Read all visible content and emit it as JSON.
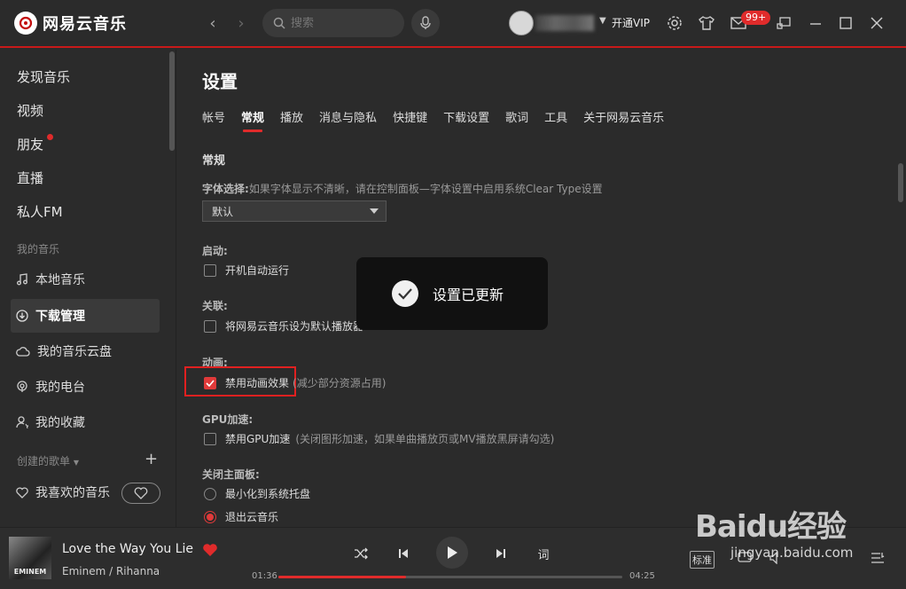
{
  "app": {
    "name": "网易云音乐"
  },
  "search": {
    "placeholder": "搜索"
  },
  "account": {
    "vip": "开通VIP",
    "badge": "99+"
  },
  "sidebar": {
    "top": [
      "发现音乐",
      "视频",
      "朋友",
      "直播",
      "私人FM"
    ],
    "my_music_title": "我的音乐",
    "my_music": [
      "本地音乐",
      "下载管理",
      "我的音乐云盘",
      "我的电台",
      "我的收藏"
    ],
    "playlists_title": "创建的歌单",
    "liked": "我喜欢的音乐"
  },
  "settings": {
    "title": "设置",
    "tabs": [
      "帐号",
      "常规",
      "播放",
      "消息与隐私",
      "快捷键",
      "下载设置",
      "歌词",
      "工具",
      "关于网易云音乐"
    ],
    "active_tab": "常规",
    "section": "常规",
    "font_label": "字体选择:",
    "font_hint": "如果字体显示不清晰，请在控制面板—字体设置中启用系统Clear Type设置",
    "font_value": "默认",
    "startup_label": "启动:",
    "startup_option": "开机自动运行",
    "assoc_label": "关联:",
    "assoc_option": "将网易云音乐设为默认播放器",
    "anim_label": "动画:",
    "anim_option": "禁用动画效果",
    "anim_note": "(减少部分资源占用)",
    "gpu_label": "GPU加速:",
    "gpu_option": "禁用GPU加速",
    "gpu_note": "(关闭图形加速，如果单曲播放页或MV播放黑屏请勾选)",
    "close_label": "关闭主面板:",
    "close_opt1": "最小化到系统托盘",
    "close_opt2": "退出云音乐"
  },
  "toast": {
    "text": "设置已更新"
  },
  "player": {
    "cover_text": "EMINEM",
    "song": "Love the Way You Lie",
    "artist": "Eminem / Rihanna",
    "elapsed": "01:36",
    "duration": "04:25",
    "progress": 0.37,
    "lyrics_btn": "词",
    "quality": "标准"
  },
  "watermark": {
    "big": "Baidu经验",
    "small": "jingyan.baidu.com"
  },
  "colors": {
    "accent": "#e02b2b",
    "bg": "#2b2b2b"
  }
}
